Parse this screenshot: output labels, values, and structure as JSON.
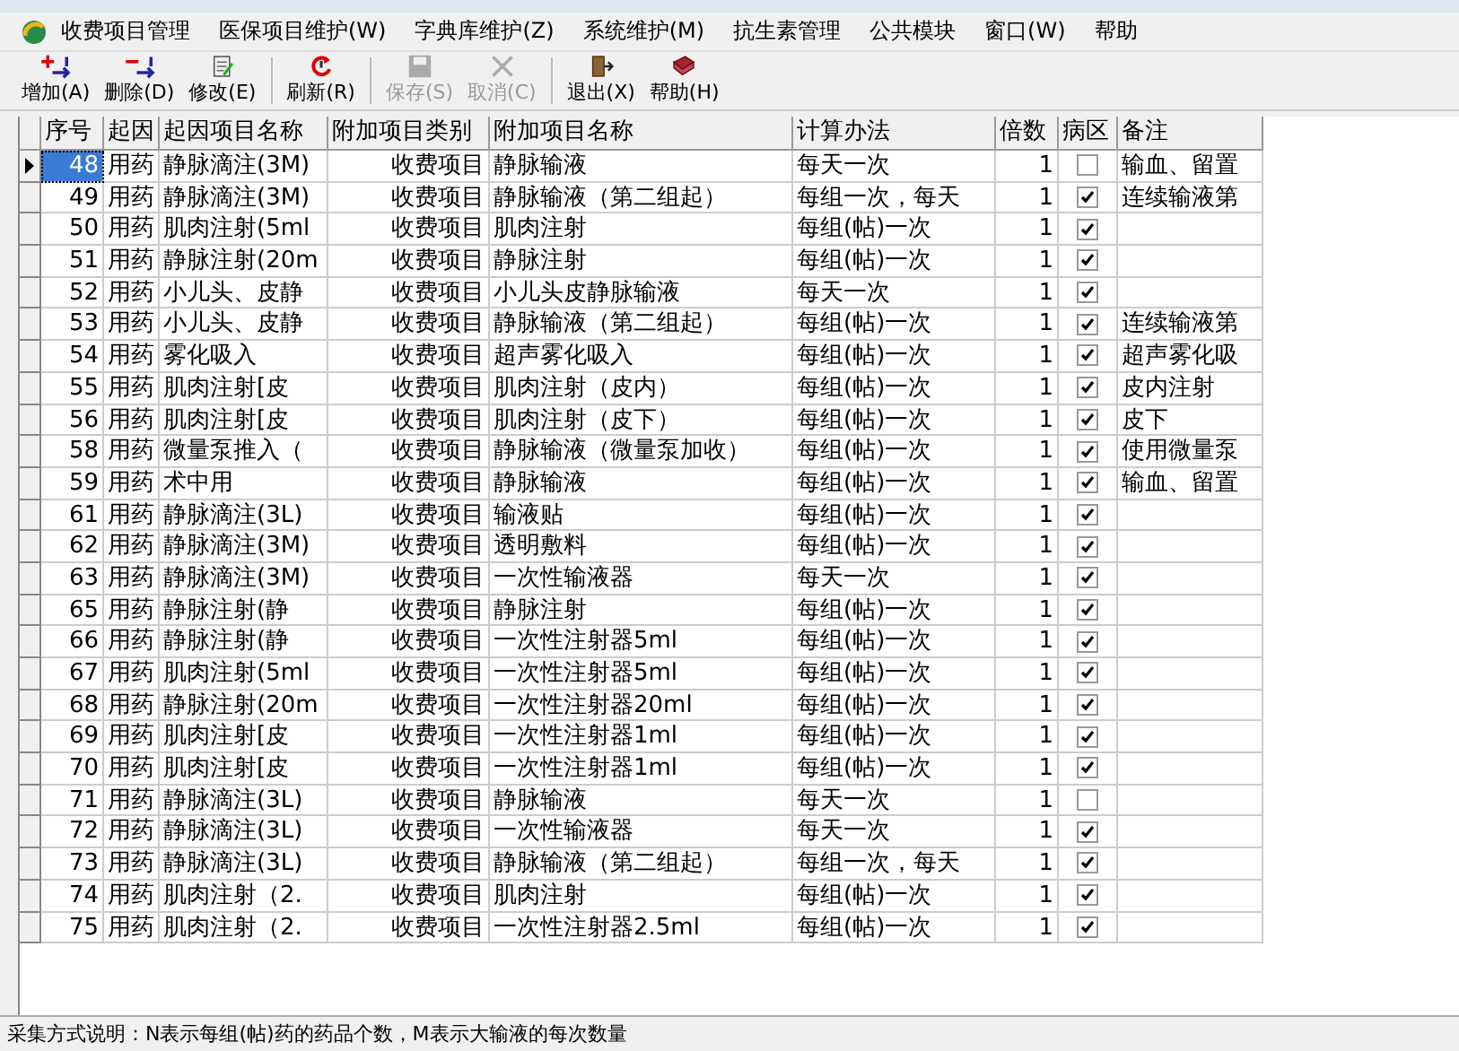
{
  "menu": [
    "收费项目管理",
    "医保项目维护(W)",
    "字典库维护(Z)",
    "系统维护(M)",
    "抗生素管理",
    "公共模块",
    "窗口(W)",
    "帮助"
  ],
  "toolbar": [
    {
      "label": "增加(A)",
      "kind": "add",
      "disabled": false
    },
    {
      "label": "删除(D)",
      "kind": "delete",
      "disabled": false
    },
    {
      "label": "修改(E)",
      "kind": "edit",
      "disabled": false
    },
    {
      "label": "刷新(R)",
      "kind": "refresh",
      "disabled": false
    },
    {
      "label": "保存(S)",
      "kind": "save",
      "disabled": true
    },
    {
      "label": "取消(C)",
      "kind": "cancel",
      "disabled": true
    },
    {
      "label": "退出(X)",
      "kind": "exit",
      "disabled": false
    },
    {
      "label": "帮助(H)",
      "kind": "help",
      "disabled": false
    }
  ],
  "table": {
    "columns": [
      "序号",
      "起因",
      "起因项目名称",
      "附加项目类别",
      "附加项目名称",
      "计算办法",
      "倍数",
      "病区",
      "备注"
    ],
    "rows": [
      {
        "no": "48",
        "cause": "用药",
        "cause_item": "静脉滴注(3M)",
        "category": "收费项目",
        "item": "静脉输液",
        "method": "每天一次",
        "multiple": "1",
        "ward": false,
        "note": "输血、留置",
        "selected": true
      },
      {
        "no": "49",
        "cause": "用药",
        "cause_item": "静脉滴注(3M)",
        "category": "收费项目",
        "item": "静脉输液（第二组起）",
        "method": "每组一次，每天",
        "multiple": "1",
        "ward": true,
        "note": "连续输液第",
        "selected": false
      },
      {
        "no": "50",
        "cause": "用药",
        "cause_item": "肌肉注射(5ml",
        "category": "收费项目",
        "item": "肌肉注射",
        "method": "每组(帖)一次",
        "multiple": "1",
        "ward": true,
        "selected": false
      },
      {
        "no": "51",
        "cause": "用药",
        "cause_item": "静脉注射(20m",
        "category": "收费项目",
        "item": "静脉注射",
        "method": "每组(帖)一次",
        "multiple": "1",
        "ward": true,
        "selected": false
      },
      {
        "no": "52",
        "cause": "用药",
        "cause_item": "小儿头、皮静",
        "category": "收费项目",
        "item": "小儿头皮静脉输液",
        "method": "每天一次",
        "multiple": "1",
        "ward": true,
        "selected": false
      },
      {
        "no": "53",
        "cause": "用药",
        "cause_item": "小儿头、皮静",
        "category": "收费项目",
        "item": "静脉输液（第二组起）",
        "method": "每组(帖)一次",
        "multiple": "1",
        "ward": true,
        "note": "连续输液第",
        "selected": false
      },
      {
        "no": "54",
        "cause": "用药",
        "cause_item": "雾化吸入",
        "category": "收费项目",
        "item": "超声雾化吸入",
        "method": "每组(帖)一次",
        "multiple": "1",
        "ward": true,
        "note": "超声雾化吸",
        "selected": false
      },
      {
        "no": "55",
        "cause": "用药",
        "cause_item": "肌肉注射[皮",
        "category": "收费项目",
        "item": "肌肉注射（皮内）",
        "method": "每组(帖)一次",
        "multiple": "1",
        "ward": true,
        "note": "皮内注射",
        "selected": false
      },
      {
        "no": "56",
        "cause": "用药",
        "cause_item": "肌肉注射[皮",
        "category": "收费项目",
        "item": "肌肉注射（皮下）",
        "method": "每组(帖)一次",
        "multiple": "1",
        "ward": true,
        "note": "皮下",
        "selected": false
      },
      {
        "no": "58",
        "cause": "用药",
        "cause_item": "微量泵推入（",
        "category": "收费项目",
        "item": "静脉输液（微量泵加收）",
        "method": "每组(帖)一次",
        "multiple": "1",
        "ward": true,
        "note": "使用微量泵",
        "selected": false
      },
      {
        "no": "59",
        "cause": "用药",
        "cause_item": "术中用",
        "category": "收费项目",
        "item": "静脉输液",
        "method": "每组(帖)一次",
        "multiple": "1",
        "ward": true,
        "note": "输血、留置",
        "selected": false
      },
      {
        "no": "61",
        "cause": "用药",
        "cause_item": "静脉滴注(3L)",
        "category": "收费项目",
        "item": "输液贴",
        "method": "每组(帖)一次",
        "multiple": "1",
        "ward": true,
        "selected": false
      },
      {
        "no": "62",
        "cause": "用药",
        "cause_item": "静脉滴注(3M)",
        "category": "收费项目",
        "item": "透明敷料",
        "method": "每组(帖)一次",
        "multiple": "1",
        "ward": true,
        "selected": false
      },
      {
        "no": "63",
        "cause": "用药",
        "cause_item": "静脉滴注(3M)",
        "category": "收费项目",
        "item": "一次性输液器",
        "method": "每天一次",
        "multiple": "1",
        "ward": true,
        "selected": false
      },
      {
        "no": "65",
        "cause": "用药",
        "cause_item": "静脉注射(静",
        "category": "收费项目",
        "item": "静脉注射",
        "method": "每组(帖)一次",
        "multiple": "1",
        "ward": true,
        "selected": false
      },
      {
        "no": "66",
        "cause": "用药",
        "cause_item": "静脉注射(静",
        "category": "收费项目",
        "item": "一次性注射器5ml",
        "method": "每组(帖)一次",
        "multiple": "1",
        "ward": true,
        "selected": false
      },
      {
        "no": "67",
        "cause": "用药",
        "cause_item": "肌肉注射(5ml",
        "category": "收费项目",
        "item": "一次性注射器5ml",
        "method": "每组(帖)一次",
        "multiple": "1",
        "ward": true,
        "selected": false
      },
      {
        "no": "68",
        "cause": "用药",
        "cause_item": "静脉注射(20m",
        "category": "收费项目",
        "item": "一次性注射器20ml",
        "method": "每组(帖)一次",
        "multiple": "1",
        "ward": true,
        "selected": false
      },
      {
        "no": "69",
        "cause": "用药",
        "cause_item": "肌肉注射[皮",
        "category": "收费项目",
        "item": "一次性注射器1ml",
        "method": "每组(帖)一次",
        "multiple": "1",
        "ward": true,
        "selected": false
      },
      {
        "no": "70",
        "cause": "用药",
        "cause_item": "肌肉注射[皮",
        "category": "收费项目",
        "item": "一次性注射器1ml",
        "method": "每组(帖)一次",
        "multiple": "1",
        "ward": true,
        "selected": false
      },
      {
        "no": "71",
        "cause": "用药",
        "cause_item": "静脉滴注(3L)",
        "category": "收费项目",
        "item": "静脉输液",
        "method": "每天一次",
        "multiple": "1",
        "ward": false,
        "selected": false
      },
      {
        "no": "72",
        "cause": "用药",
        "cause_item": "静脉滴注(3L)",
        "category": "收费项目",
        "item": "一次性输液器",
        "method": "每天一次",
        "multiple": "1",
        "ward": true,
        "selected": false
      },
      {
        "no": "73",
        "cause": "用药",
        "cause_item": "静脉滴注(3L)",
        "category": "收费项目",
        "item": "静脉输液（第二组起）",
        "method": "每组一次，每天",
        "multiple": "1",
        "ward": true,
        "selected": false
      },
      {
        "no": "74",
        "cause": "用药",
        "cause_item": "肌肉注射（2.",
        "category": "收费项目",
        "item": "肌肉注射",
        "method": "每组(帖)一次",
        "multiple": "1",
        "ward": true,
        "selected": false
      },
      {
        "no": "75",
        "cause": "用药",
        "cause_item": "肌肉注射（2.",
        "category": "收费项目",
        "item": "一次性注射器2.5ml",
        "method": "每组(帖)一次",
        "multiple": "1",
        "ward": true,
        "selected": false
      }
    ]
  },
  "status_bar": "采集方式说明：N表示每组(帖)药的药品个数，M表示大输液的每次数量"
}
